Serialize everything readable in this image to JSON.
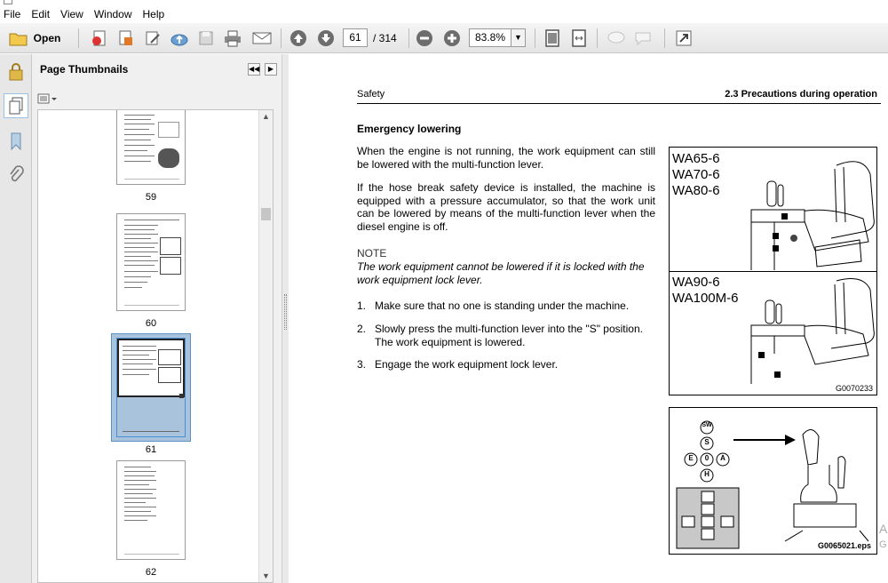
{
  "menu": [
    "File",
    "Edit",
    "View",
    "Window",
    "Help"
  ],
  "toolbar": {
    "open_label": "Open",
    "current_page": "61",
    "page_total": "/ 314",
    "zoom": "83.8%"
  },
  "panel": {
    "title": "Page Thumbnails",
    "thumbnails": [
      {
        "label": "59"
      },
      {
        "label": "60"
      },
      {
        "label": "61"
      },
      {
        "label": "62"
      }
    ]
  },
  "document": {
    "header_left": "Safety",
    "header_right": "2.3  Precautions during operation",
    "heading": "Emergency lowering",
    "paragraphs": [
      "When the engine is not running, the work equipment can still be lowered with the multi-function lever.",
      "If the hose break safety device is installed, the machine is equipped with a pressure accumulator, so that the work unit can be lowered by means of the multi-function lever when the diesel engine is off."
    ],
    "note_heading": "NOTE",
    "note_text": "The work equipment cannot be lowered if it is locked with the work equipment lock lever.",
    "steps": [
      {
        "n": "1.",
        "text": "Make sure that no one is standing under the machine."
      },
      {
        "n": "2.",
        "text": "Slowly press the multi-function lever into the \"S\" position. The work equipment is lowered."
      },
      {
        "n": "3.",
        "text": "Engage the work equipment lock lever."
      }
    ],
    "figure1": {
      "labels_top": [
        "WA65-6",
        "WA70-6",
        "WA80-6"
      ],
      "labels_bottom": [
        "WA90-6",
        "WA100M-6"
      ],
      "code": "G0070233"
    },
    "figure2": {
      "code": "G0065021.eps",
      "keys": [
        "SW",
        "S",
        "E",
        "0",
        "A",
        "H"
      ]
    },
    "edge_fragments": [
      "A",
      "G"
    ]
  }
}
